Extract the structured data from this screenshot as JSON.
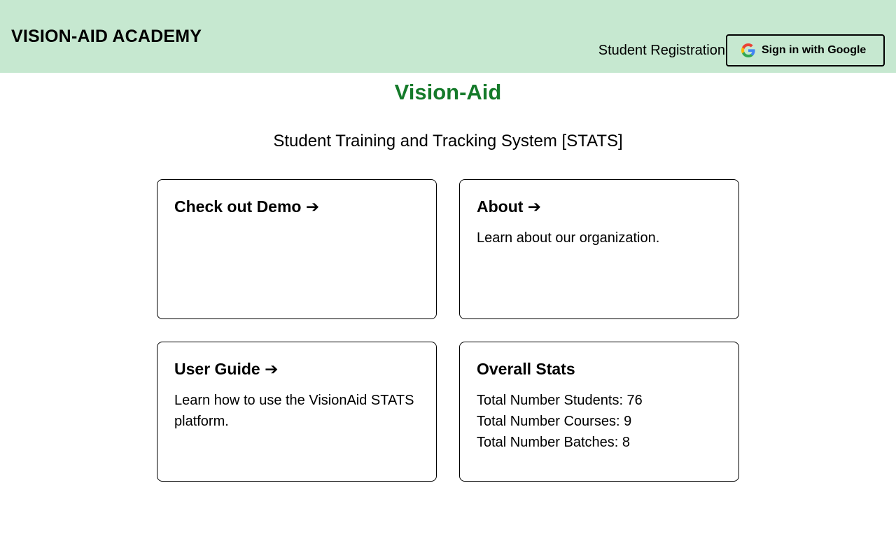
{
  "header": {
    "brand": "VISION-AID ACADEMY",
    "nav_link": "Student Registration",
    "signin_label": "Sign in with Google",
    "signin_icon": "google-logo-icon",
    "background_color": "#c6e8d0"
  },
  "main": {
    "title": "Vision-Aid",
    "title_color": "#157a2a",
    "subtitle": "Student Training and Tracking System [STATS]"
  },
  "cards": {
    "demo": {
      "title": "Check out Demo ➔",
      "description": ""
    },
    "about": {
      "title": "About ➔",
      "description": "Learn about our organization."
    },
    "guide": {
      "title": "User Guide ➔",
      "description": "Learn how to use the VisionAid STATS platform."
    },
    "stats": {
      "title": "Overall Stats",
      "students": "Total Number Students: 76",
      "courses": "Total Number Courses: 9",
      "batches": "Total Number Batches: 8"
    }
  }
}
